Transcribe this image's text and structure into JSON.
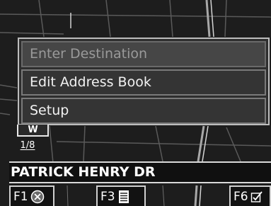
{
  "menu": {
    "items": [
      {
        "label": "Enter Destination",
        "state": "disabled"
      },
      {
        "label": "Edit Address Book",
        "state": "enabled"
      },
      {
        "label": "Setup",
        "state": "enabled"
      }
    ]
  },
  "map": {
    "heading": "W",
    "scale": "1/8",
    "street_name": "PATRICK HENRY DR"
  },
  "function_keys": [
    {
      "label": "F1",
      "icon": "cancel-circle-icon"
    },
    {
      "label": "F3",
      "icon": "list-document-icon"
    },
    {
      "label": "F6",
      "icon": "checkbox-edit-icon"
    }
  ]
}
